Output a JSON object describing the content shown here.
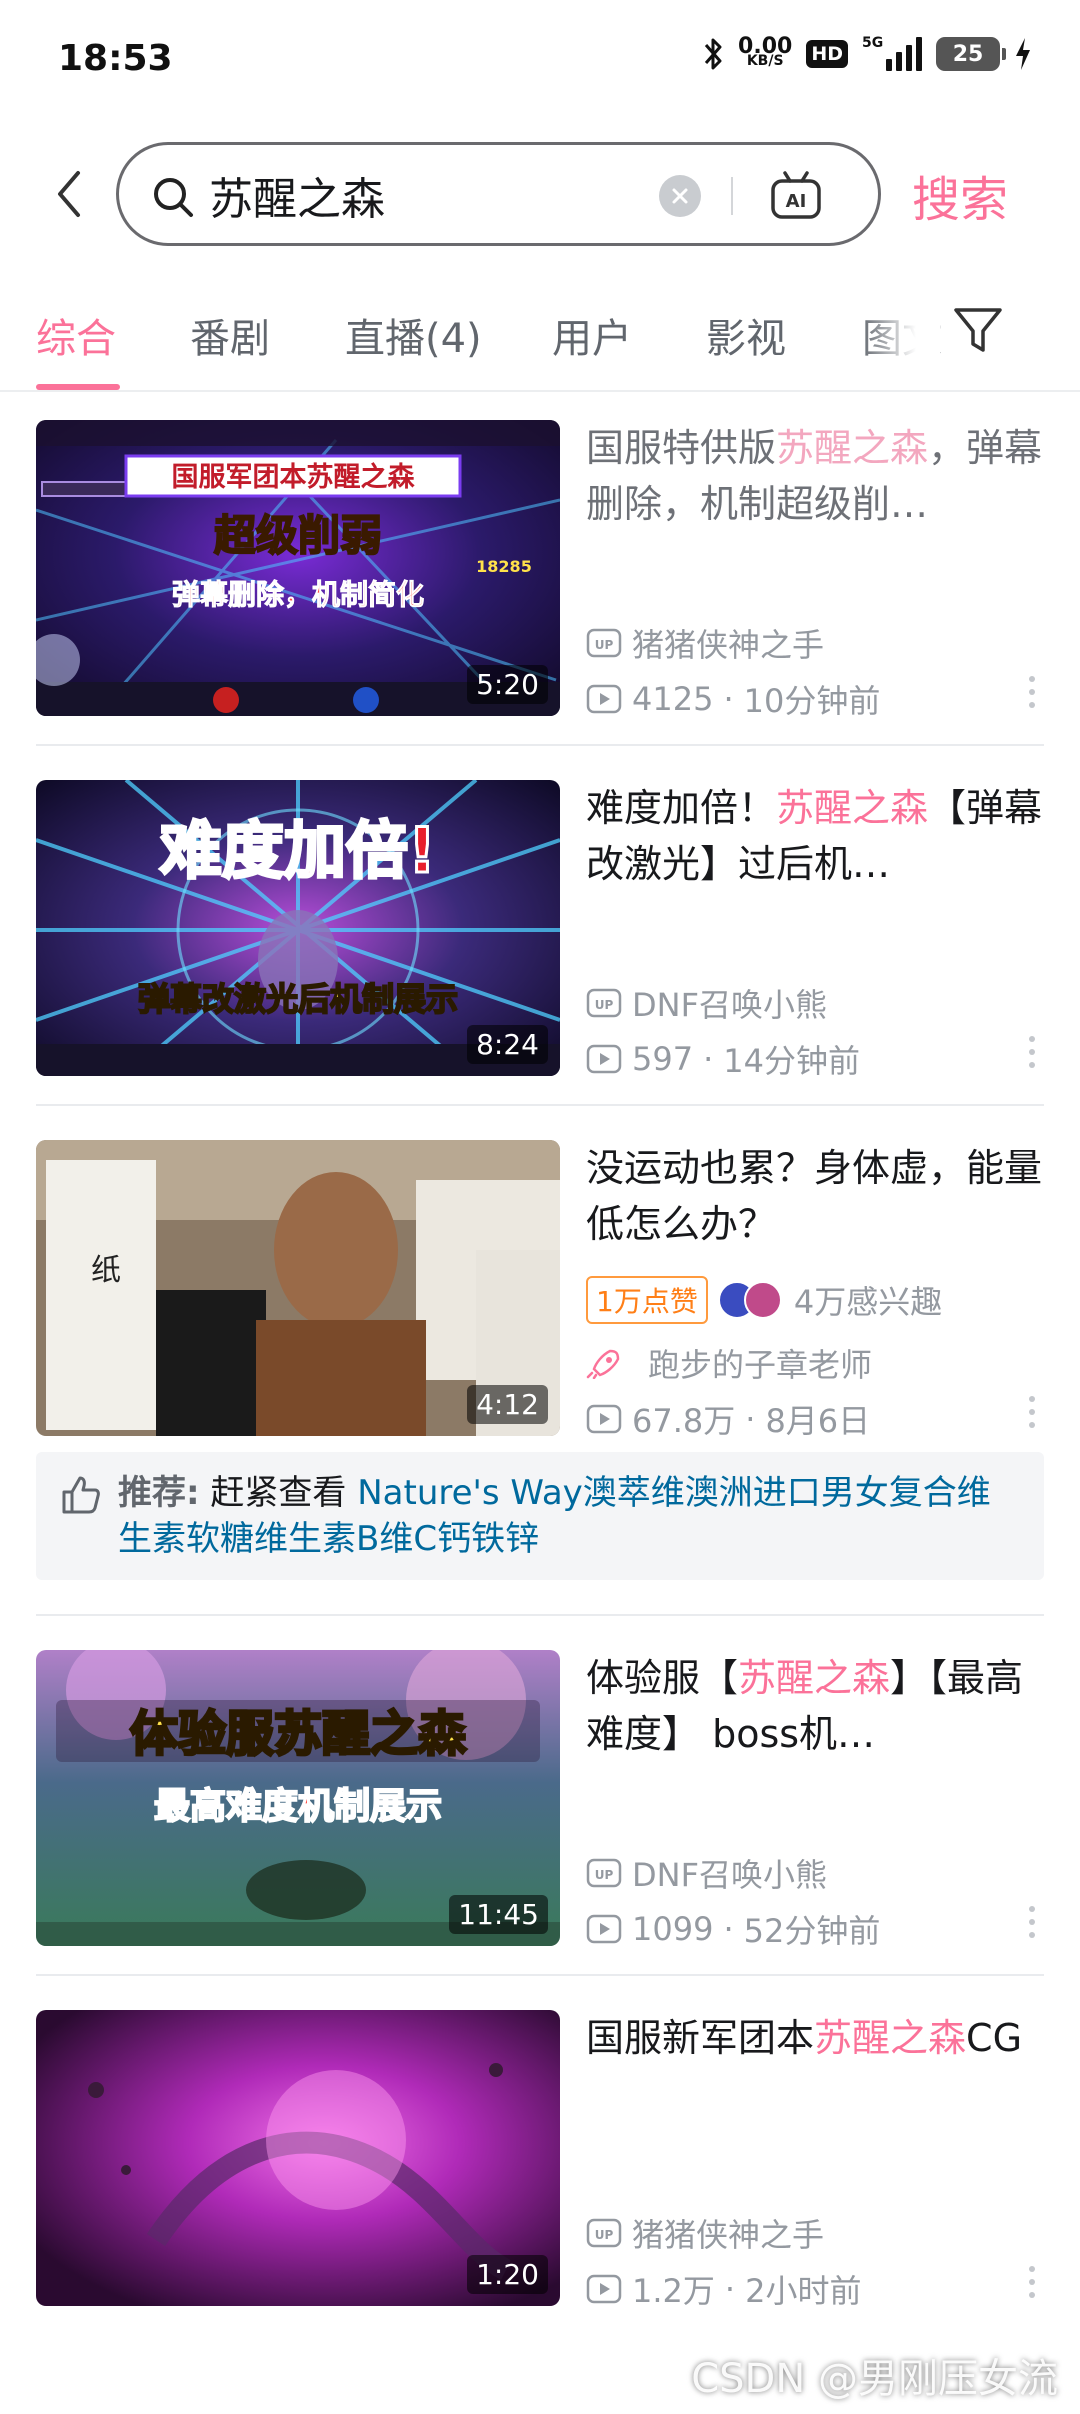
{
  "status_bar": {
    "time": "18:53",
    "net_speed_value": "0.00",
    "net_speed_unit": "KB/S",
    "hd_label": "HD",
    "signal_label": "5G",
    "battery_level": "25",
    "icons": [
      "bluetooth-icon",
      "signal-icon",
      "battery-icon",
      "charging-icon"
    ]
  },
  "search": {
    "query": "苏醒之森",
    "submit_label": "搜索",
    "ai_icon_label": "AI"
  },
  "tabs": [
    {
      "label": "综合",
      "active": true
    },
    {
      "label": "番剧",
      "active": false
    },
    {
      "label": "直播(4)",
      "active": false
    },
    {
      "label": "用户",
      "active": false
    },
    {
      "label": "影视",
      "active": false
    },
    {
      "label": "图文",
      "active": false
    }
  ],
  "videos": [
    {
      "title_pre": "国服特供版",
      "title_hl": "苏醒之森",
      "title_post": "，弹幕删除，机制超级削…",
      "duration": "5:20",
      "uploader": "猪猪侠神之手",
      "plays": "4125",
      "time_ago": "10分钟前",
      "thumb_text": [
        "国服军团本苏醒之森",
        "超级削弱",
        "弹幕删除，机制简化"
      ],
      "thumb_hud": "18285"
    },
    {
      "title_pre": "难度加倍！",
      "title_hl": "苏醒之森",
      "title_post": "【弹幕改激光】过后机…",
      "duration": "8:24",
      "uploader": "DNF召唤小熊",
      "plays": "597",
      "time_ago": "14分钟前",
      "thumb_text": [
        "难度加倍!",
        "弹幕改激光后机制展示"
      ]
    },
    {
      "title": "没运动也累？身体虚，能量低怎么办？",
      "duration": "4:12",
      "likes_badge": "1万点赞",
      "interest": "4万感兴趣",
      "uploader": "跑步的子章老师",
      "plays": "67.8万",
      "time_ago": "8月6日",
      "thumb_text": [
        "纸"
      ]
    },
    {
      "title_pre": "体验服【",
      "title_hl": "苏醒之森",
      "title_post": "】【最高难度】 boss机…",
      "duration": "11:45",
      "uploader": "DNF召唤小熊",
      "plays": "1099",
      "time_ago": "52分钟前",
      "thumb_text": [
        "体验服苏醒之森",
        "最高难度机制展示"
      ]
    },
    {
      "title_pre": "国服新军团本",
      "title_hl": "苏醒之森",
      "title_post": "CG",
      "duration": "1:20",
      "uploader": "猪猪侠神之手",
      "plays": "1.2万",
      "time_ago": "2小时前"
    }
  ],
  "recommendation": {
    "label": "推荐:",
    "prefix": "赶紧查看",
    "link": "Nature's Way澳萃维澳洲进口男女复合维生素软糖维生素B维C钙铁锌"
  },
  "watermark": "CSDN @男刚压女流",
  "colors": {
    "accent": "#fb7299",
    "link": "#00699d",
    "meta": "#9499a0",
    "likes_badge": "#ff7f17"
  }
}
